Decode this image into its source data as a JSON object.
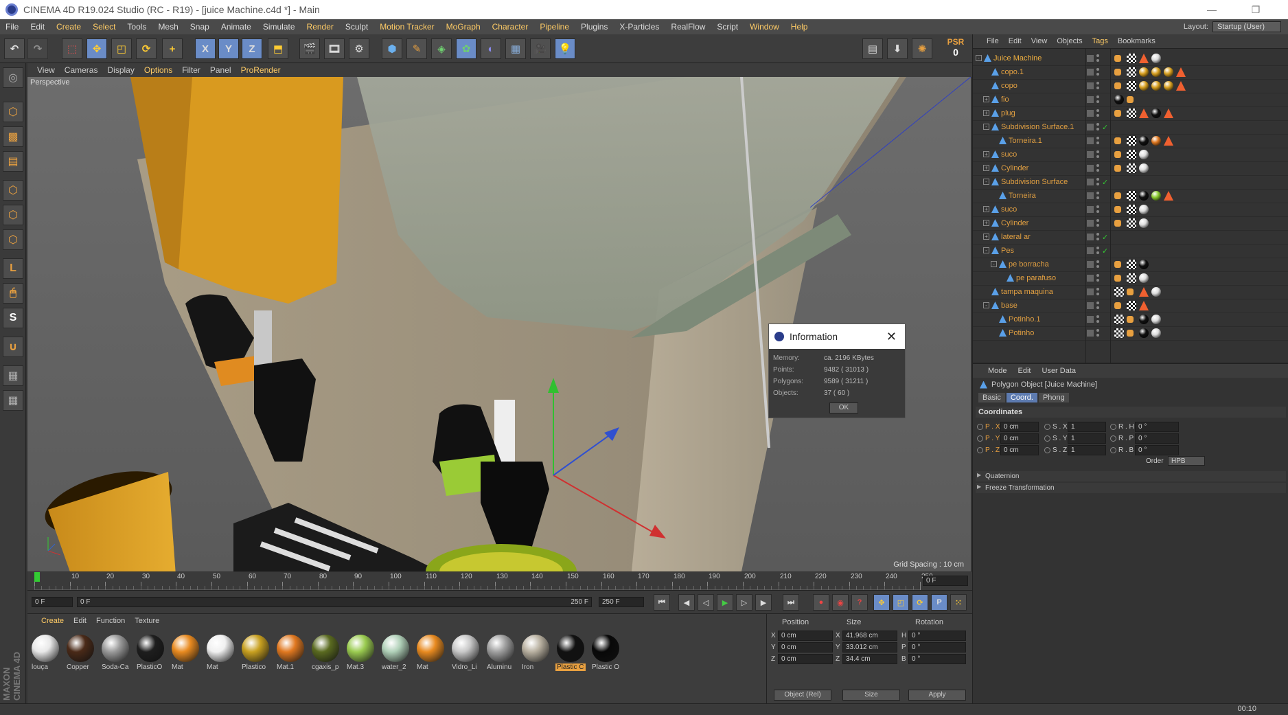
{
  "window": {
    "title": "CINEMA 4D R19.024 Studio (RC - R19) - [juice Machine.c4d *] - Main"
  },
  "menu": {
    "items": [
      "File",
      "Edit",
      "Create",
      "Select",
      "Tools",
      "Mesh",
      "Snap",
      "Animate",
      "Simulate",
      "Render",
      "Sculpt",
      "Motion Tracker",
      "MoGraph",
      "Character",
      "Pipeline",
      "Plugins",
      "X-Particles",
      "RealFlow",
      "Script",
      "Window",
      "Help"
    ],
    "layout_label": "Layout:",
    "layout_value": "Startup (User)"
  },
  "toolbar": {
    "psr_label": "PSR",
    "psr_value": "0",
    "axis_x": "X",
    "axis_y": "Y",
    "axis_z": "Z"
  },
  "viewport": {
    "menu": [
      "View",
      "Cameras",
      "Display",
      "Options",
      "Filter",
      "Panel",
      "ProRender"
    ],
    "label": "Perspective",
    "grid_spacing": "Grid Spacing : 10 cm"
  },
  "info_dialog": {
    "title": "Information",
    "memory_label": "Memory:",
    "memory_value": "ca. 2196 KBytes",
    "points_label": "Points:",
    "points_value": "9482 ( 31013 )",
    "polygons_label": "Polygons:",
    "polygons_value": "9589 ( 31211 )",
    "objects_label": "Objects:",
    "objects_value": "37 ( 60 )",
    "ok_label": "OK"
  },
  "timeline": {
    "ticks": [
      "0",
      "10",
      "20",
      "30",
      "40",
      "50",
      "60",
      "70",
      "80",
      "90",
      "100",
      "110",
      "120",
      "130",
      "140",
      "150",
      "160",
      "170",
      "180",
      "190",
      "200",
      "210",
      "220",
      "230",
      "240",
      "250"
    ],
    "current_frame": "0 F",
    "start_field": "0 F",
    "range_start": "0 F",
    "range_end": "250 F",
    "end_field": "250 F"
  },
  "materials": {
    "menu": [
      "Create",
      "Edit",
      "Function",
      "Texture"
    ],
    "items": [
      {
        "name": "louça",
        "color": "#e8e8e8"
      },
      {
        "name": "Copper",
        "color": "#4a2a18"
      },
      {
        "name": "Soda-Ca",
        "color": "#9a9a9a"
      },
      {
        "name": "PlasticO",
        "color": "#1e1e1e"
      },
      {
        "name": "Mat",
        "color": "#e88a20"
      },
      {
        "name": "Mat",
        "color": "#f0f0f0"
      },
      {
        "name": "Plastico",
        "color": "#c8a020"
      },
      {
        "name": "Mat.1",
        "color": "#e07820"
      },
      {
        "name": "cgaxis_p",
        "color": "#5a6a20"
      },
      {
        "name": "Mat.3",
        "color": "#9acb50"
      },
      {
        "name": "water_2",
        "color": "#b0d0b8"
      },
      {
        "name": "Mat",
        "color": "#e88a20"
      },
      {
        "name": "Vidro_Li",
        "color": "#c8c8c8"
      },
      {
        "name": "Aluminu",
        "color": "#a0a0a0"
      },
      {
        "name": "Iron",
        "color": "#b8b0a0"
      },
      {
        "name": "Plastic C",
        "color": "#111111"
      },
      {
        "name": "Plastic O",
        "color": "#080808"
      }
    ],
    "brand": "MAXON CINEMA 4D"
  },
  "coords": {
    "headers": {
      "position": "Position",
      "size": "Size",
      "rotation": "Rotation"
    },
    "rows": [
      {
        "axis": "X",
        "pos": "0 cm",
        "size_axis": "X",
        "size": "41.968 cm",
        "rot_axis": "H",
        "rot": "0 °"
      },
      {
        "axis": "Y",
        "pos": "0 cm",
        "size_axis": "Y",
        "size": "33.012 cm",
        "rot_axis": "P",
        "rot": "0 °"
      },
      {
        "axis": "Z",
        "pos": "0 cm",
        "size_axis": "Z",
        "size": "34.4 cm",
        "rot_axis": "B",
        "rot": "0 °"
      }
    ],
    "mode_select": "Object (Rel)",
    "size_select": "Size",
    "apply_label": "Apply"
  },
  "object_manager": {
    "menu": [
      "File",
      "Edit",
      "View",
      "Objects",
      "Tags",
      "Bookmarks"
    ],
    "objects": [
      {
        "name": "Juice Machine",
        "indent": 0,
        "tree": "-",
        "top": true,
        "tags": [
          "org",
          "chk",
          "tri",
          "sph"
        ]
      },
      {
        "name": "copo.1",
        "indent": 1,
        "tree": "",
        "tags": [
          "org",
          "chk",
          "gold",
          "gold",
          "gold",
          "tri"
        ]
      },
      {
        "name": "copo",
        "indent": 1,
        "tree": "",
        "tags": [
          "org",
          "chk",
          "gold",
          "gold",
          "gold",
          "tri"
        ]
      },
      {
        "name": "fio",
        "indent": 1,
        "tree": "+",
        "tags": [
          "blk",
          "org"
        ]
      },
      {
        "name": "plug",
        "indent": 1,
        "tree": "+",
        "tags": [
          "org",
          "chk",
          "tri",
          "blk",
          "tri"
        ]
      },
      {
        "name": "Subdivision Surface.1",
        "indent": 1,
        "tree": "-",
        "tags": []
      },
      {
        "name": "Torneira.1",
        "indent": 2,
        "tree": "",
        "tags": [
          "org",
          "chk",
          "blk",
          "orange",
          "tri"
        ]
      },
      {
        "name": "suco",
        "indent": 1,
        "tree": "+",
        "tags": [
          "org",
          "chk",
          "sph"
        ]
      },
      {
        "name": "Cylinder",
        "indent": 1,
        "tree": "+",
        "tags": [
          "org",
          "chk",
          "sph"
        ]
      },
      {
        "name": "Subdivision Surface",
        "indent": 1,
        "tree": "-",
        "tags": []
      },
      {
        "name": "Torneira",
        "indent": 2,
        "tree": "",
        "tags": [
          "org",
          "chk",
          "blk",
          "green",
          "tri"
        ]
      },
      {
        "name": "suco",
        "indent": 1,
        "tree": "+",
        "tags": [
          "org",
          "chk",
          "sph"
        ]
      },
      {
        "name": "Cylinder",
        "indent": 1,
        "tree": "+",
        "tags": [
          "org",
          "chk",
          "sph"
        ]
      },
      {
        "name": "lateral ar",
        "indent": 1,
        "tree": "+",
        "tags": []
      },
      {
        "name": "Pes",
        "indent": 1,
        "tree": "-",
        "tags": []
      },
      {
        "name": "pe borracha",
        "indent": 2,
        "tree": "-",
        "tags": [
          "org",
          "chk",
          "blk"
        ]
      },
      {
        "name": "pe parafuso",
        "indent": 3,
        "tree": "",
        "tags": [
          "org",
          "chk",
          "sph"
        ]
      },
      {
        "name": "tampa maquina",
        "indent": 1,
        "tree": "",
        "tags": [
          "chk",
          "org",
          "tri",
          "sph"
        ]
      },
      {
        "name": "base",
        "indent": 1,
        "tree": "-",
        "tags": [
          "org",
          "chk",
          "tri"
        ]
      },
      {
        "name": "Potinho.1",
        "indent": 2,
        "tree": "",
        "tags": [
          "chk",
          "org",
          "blk",
          "sph"
        ]
      },
      {
        "name": "Potinho",
        "indent": 2,
        "tree": "",
        "tags": [
          "chk",
          "org",
          "blk",
          "sph"
        ]
      }
    ]
  },
  "attributes": {
    "menu": [
      "Mode",
      "Edit",
      "User Data"
    ],
    "object_title": "Polygon Object [Juice Machine]",
    "tabs": [
      "Basic",
      "Coord.",
      "Phong"
    ],
    "active_tab": "Coord.",
    "section": "Coordinates",
    "fields": [
      {
        "label": "P . X",
        "value": "0 cm",
        "slabel": "S . X",
        "svalue": "1",
        "rlabel": "R . H",
        "rvalue": "0 °"
      },
      {
        "label": "P . Y",
        "value": "0 cm",
        "slabel": "S . Y",
        "svalue": "1",
        "rlabel": "R . P",
        "rvalue": "0 °"
      },
      {
        "label": "P . Z",
        "value": "0 cm",
        "slabel": "S . Z",
        "svalue": "1",
        "rlabel": "R . B",
        "rvalue": "0 °"
      }
    ],
    "order_label": "Order",
    "order_value": "HPB",
    "groups": [
      "Quaternion",
      "Freeze Transformation"
    ]
  },
  "statusbar": {
    "clock": "00:10"
  }
}
